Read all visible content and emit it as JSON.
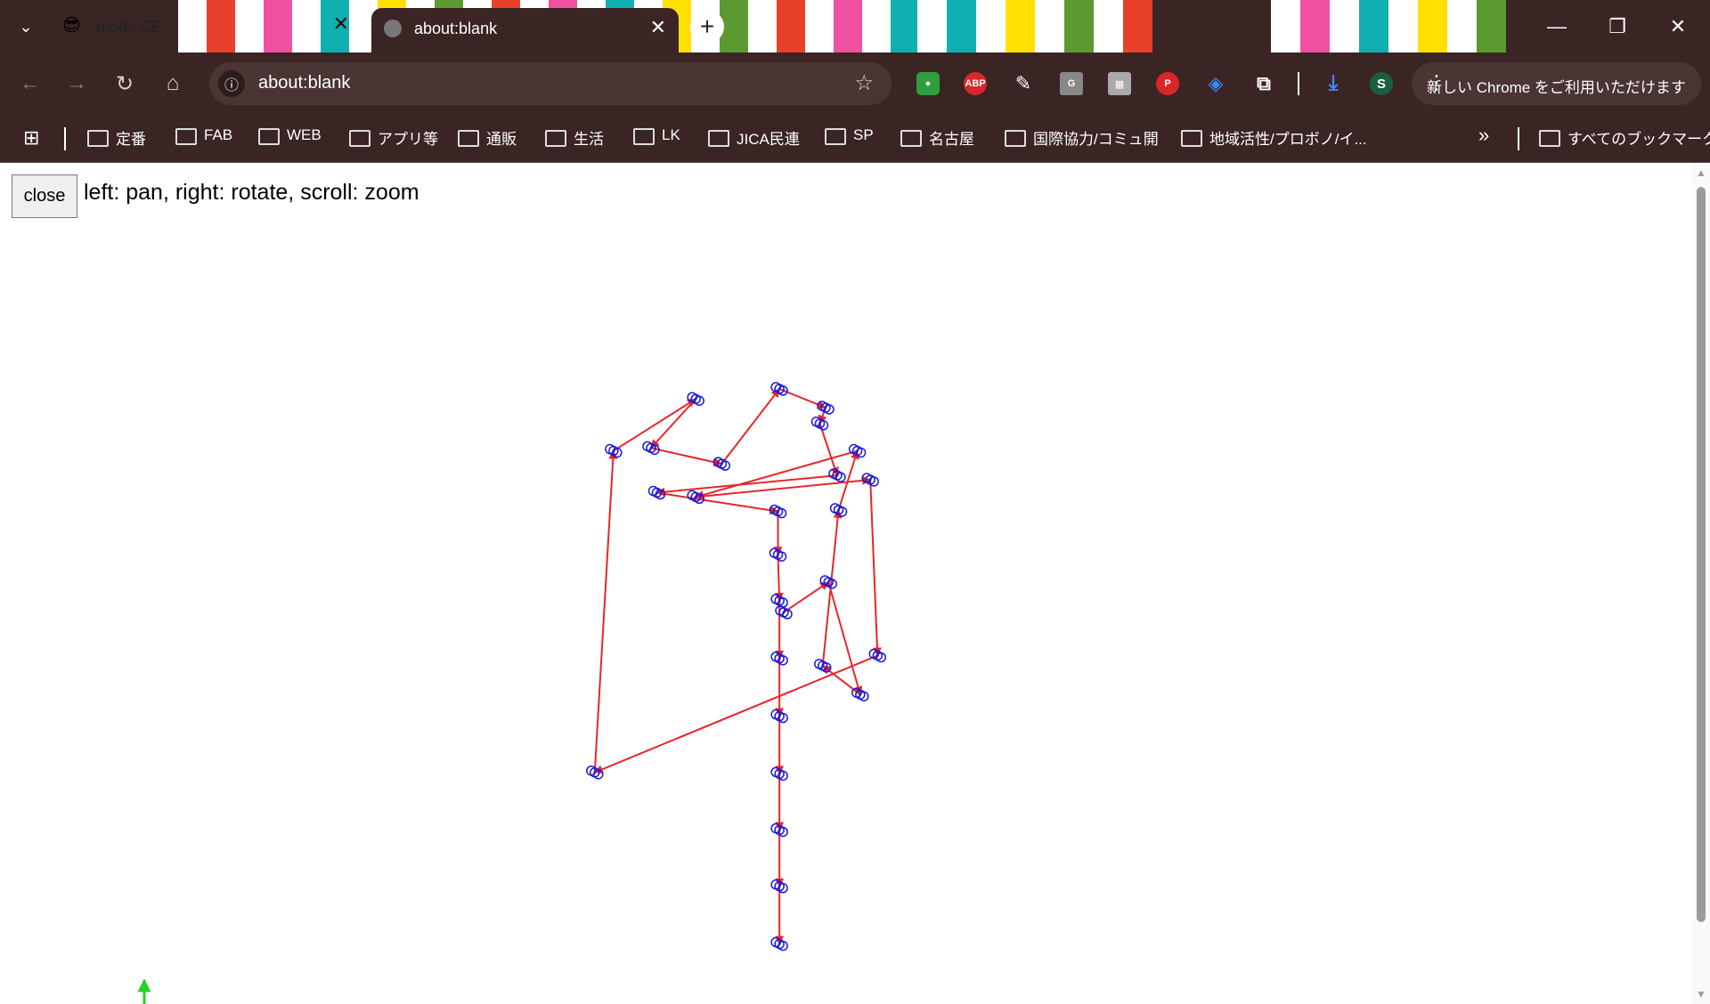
{
  "tabs": [
    {
      "title": "mods CE",
      "favicon": "sunglasses-emoji-icon",
      "close": "✕"
    },
    {
      "title": "about:blank",
      "favicon": "globe-icon",
      "close": "✕"
    }
  ],
  "newtab_label": "+",
  "window_controls": [
    "—",
    "❐",
    "✕"
  ],
  "address": {
    "url": "about:blank"
  },
  "extensions": [
    "evernote-icon",
    "abp-icon",
    "eyedropper-icon",
    "google-translate-icon",
    "color-icon",
    "pinterest-icon",
    "tag-icon",
    "puzzle-icon",
    "download-icon",
    "profile-avatar"
  ],
  "profile_initial": "S",
  "promo": {
    "text": "新しい Chrome をご利用いただけます"
  },
  "bookmarks": [
    "定番",
    "FAB",
    "WEB",
    "アプリ等",
    "通販",
    "生活",
    "LK",
    "JICA民連",
    "SP",
    "名古屋",
    "国際協力/コミュ開",
    "地域活性/プロボノ/イ..."
  ],
  "bookmarks_more": "»",
  "bookmarks_all": "すべてのブックマーク",
  "page": {
    "close_label": "close",
    "help_text": "left: pan, right: rotate, scroll: zoom"
  },
  "colors": {
    "frame": "#3a2424",
    "path": "#e8262a",
    "points": "#1a1adb",
    "axis": "#22d422"
  },
  "toolpath": [
    [
      0,
      0
    ],
    [
      31,
      -21
    ],
    [
      53,
      57
    ],
    [
      27,
      37
    ],
    [
      38,
      -71
    ],
    [
      51,
      -112
    ],
    [
      -61,
      -80
    ],
    [
      60,
      -92
    ],
    [
      65,
      30
    ],
    [
      -131,
      111
    ],
    [
      -118,
      -112
    ],
    [
      -61,
      -148
    ],
    [
      -92,
      -114
    ],
    [
      -43,
      -103
    ],
    [
      -3,
      -155
    ],
    [
      29,
      -142
    ],
    [
      25,
      -131
    ],
    [
      37,
      -95
    ],
    [
      -88,
      -83
    ],
    [
      -4,
      -70
    ],
    [
      -4,
      -40
    ],
    [
      -3,
      -8
    ],
    [
      -3,
      32
    ],
    [
      -3,
      72
    ],
    [
      -3,
      112
    ],
    [
      -3,
      151
    ],
    [
      -3,
      190
    ],
    [
      -3,
      230
    ]
  ]
}
